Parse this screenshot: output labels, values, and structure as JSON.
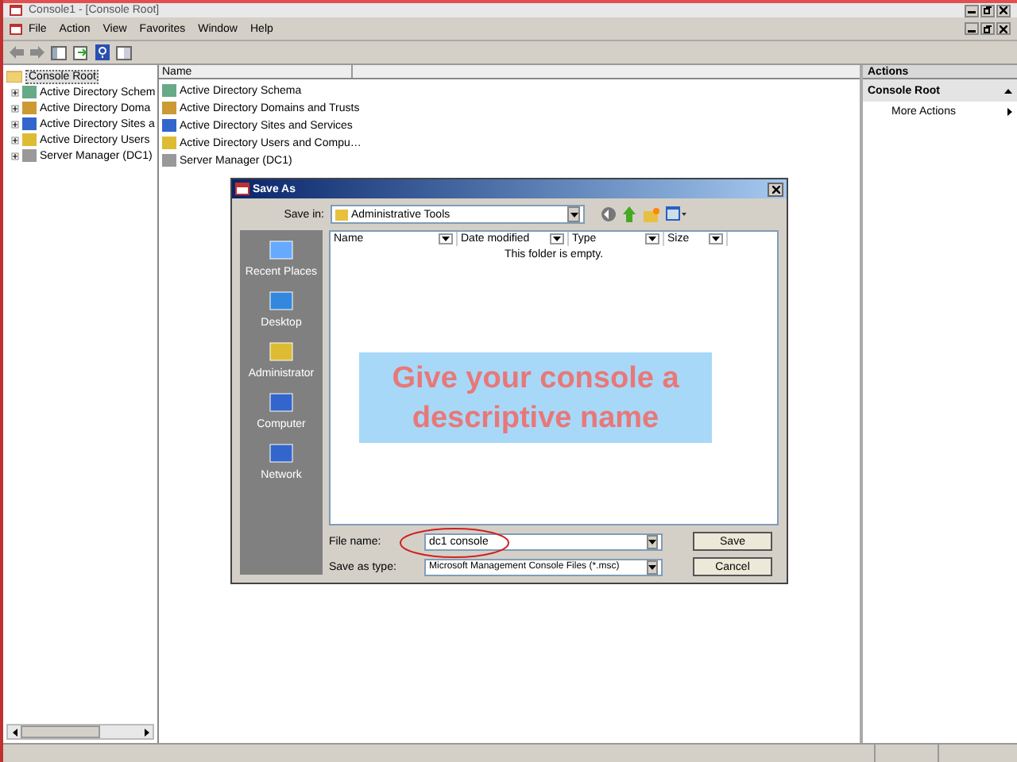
{
  "window": {
    "title": "Console1 - [Console Root]"
  },
  "menu": [
    "File",
    "Action",
    "View",
    "Favorites",
    "Window",
    "Help"
  ],
  "tree": {
    "label": "Console Root",
    "selected": true,
    "children": [
      {
        "label": "Active Directory Schem"
      },
      {
        "label": "Active Directory Doma"
      },
      {
        "label": "Active Directory Sites a"
      },
      {
        "label": "Active Directory Users"
      },
      {
        "label": "Server Manager (DC1)"
      }
    ]
  },
  "list": {
    "columns": [
      "Name"
    ],
    "items": [
      "Active Directory Schema",
      "Active Directory Domains and Trusts",
      "Active Directory Sites and Services",
      "Active Directory Users and Compu…",
      "Server Manager (DC1)"
    ]
  },
  "actions": {
    "title": "Actions",
    "section": "Console Root",
    "items": [
      "More Actions"
    ]
  },
  "dialog": {
    "title": "Save As",
    "save_in_label": "Save in:",
    "save_in": "Administrative Tools",
    "places": [
      "Recent Places",
      "Desktop",
      "Administrator",
      "Computer",
      "Network"
    ],
    "columns": [
      "Name",
      "Date modified",
      "Type",
      "Size"
    ],
    "empty_text": "This folder is empty.",
    "file_name_label": "File name:",
    "file_name": "dc1 console",
    "type_label": "Save as type:",
    "type": "Microsoft Management Console Files (*.msc)",
    "buttons": [
      "Save",
      "Cancel"
    ]
  },
  "callout": {
    "text": "Give your console a descriptive name"
  }
}
